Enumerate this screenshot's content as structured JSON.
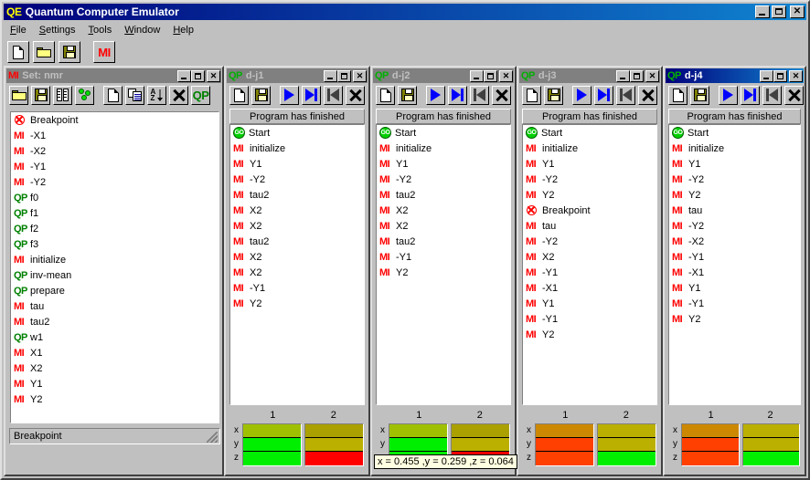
{
  "app": {
    "title": "Quantum Computer Emulator",
    "title_icon": "QE",
    "sys": {
      "minimize": "–",
      "maximize": "□",
      "close": "✕"
    }
  },
  "menu": {
    "items": [
      {
        "label": "File",
        "accel": "F"
      },
      {
        "label": "Settings",
        "accel": "S"
      },
      {
        "label": "Tools",
        "accel": "T"
      },
      {
        "label": "Window",
        "accel": "W"
      },
      {
        "label": "Help",
        "accel": "H"
      }
    ]
  },
  "toolbar": {
    "buttons": [
      {
        "name": "new-file-button",
        "icon": "new-document-icon"
      },
      {
        "name": "open-file-button",
        "icon": "open-folder-icon"
      },
      {
        "name": "save-file-button",
        "icon": "floppy-save-icon"
      },
      {
        "name": "mi-button",
        "icon": "mi-icon",
        "label": "MI"
      }
    ]
  },
  "set_window": {
    "title": "Set: nmr",
    "title_icon": "MI",
    "active": false,
    "toolbar": [
      {
        "name": "open-set-button",
        "icon": "open-folder-icon"
      },
      {
        "name": "save-set-button",
        "icon": "floppy-save-icon"
      },
      {
        "name": "machine-button",
        "icon": "two-towers-icon"
      },
      {
        "name": "qubits-button",
        "icon": "green-dots-icon"
      },
      {
        "name": "new-item-button",
        "icon": "new-document-icon"
      },
      {
        "name": "copy-item-button",
        "icon": "copy-pages-icon"
      },
      {
        "name": "sort-button",
        "icon": "sort-az-icon"
      },
      {
        "name": "delete-button",
        "icon": "delete-x-icon"
      },
      {
        "name": "qp-button",
        "icon": "qp-icon",
        "label": "QP"
      }
    ],
    "items": [
      {
        "tag": "BP",
        "label": "Breakpoint"
      },
      {
        "tag": "MI",
        "label": "-X1"
      },
      {
        "tag": "MI",
        "label": "-X2"
      },
      {
        "tag": "MI",
        "label": "-Y1"
      },
      {
        "tag": "MI",
        "label": "-Y2"
      },
      {
        "tag": "QP",
        "label": "f0"
      },
      {
        "tag": "QP",
        "label": "f1"
      },
      {
        "tag": "QP",
        "label": "f2"
      },
      {
        "tag": "QP",
        "label": "f3"
      },
      {
        "tag": "MI",
        "label": "initialize"
      },
      {
        "tag": "QP",
        "label": "inv-mean"
      },
      {
        "tag": "QP",
        "label": "prepare"
      },
      {
        "tag": "MI",
        "label": "tau"
      },
      {
        "tag": "MI",
        "label": "tau2"
      },
      {
        "tag": "QP",
        "label": "w1"
      },
      {
        "tag": "MI",
        "label": "X1"
      },
      {
        "tag": "MI",
        "label": "X2"
      },
      {
        "tag": "MI",
        "label": "Y1"
      },
      {
        "tag": "MI",
        "label": "Y2"
      }
    ],
    "status": "Breakpoint"
  },
  "program_windows": [
    {
      "name": "d-j1",
      "title": "d-j1",
      "title_icon": "QP",
      "active": false,
      "status_header": "Program has finished",
      "toolbar": [
        {
          "name": "new-program-button",
          "icon": "new-document-icon"
        },
        {
          "name": "save-program-button",
          "icon": "floppy-save-icon"
        },
        {
          "name": "run-button",
          "icon": "play-icon"
        },
        {
          "name": "run-to-end-button",
          "icon": "play-to-end-icon"
        },
        {
          "name": "rewind-button",
          "icon": "rewind-icon"
        },
        {
          "name": "stop-button",
          "icon": "delete-x-icon"
        }
      ],
      "items": [
        {
          "tag": "GO",
          "label": "Start"
        },
        {
          "tag": "MI",
          "label": "initialize"
        },
        {
          "tag": "MI",
          "label": "Y1"
        },
        {
          "tag": "MI",
          "label": "-Y2"
        },
        {
          "tag": "MI",
          "label": "tau2"
        },
        {
          "tag": "MI",
          "label": "X2"
        },
        {
          "tag": "MI",
          "label": "X2"
        },
        {
          "tag": "MI",
          "label": "tau2"
        },
        {
          "tag": "MI",
          "label": "X2"
        },
        {
          "tag": "MI",
          "label": "X2"
        },
        {
          "tag": "MI",
          "label": "-Y1"
        },
        {
          "tag": "MI",
          "label": "Y2"
        }
      ],
      "bloch": {
        "columns": [
          "1",
          "2"
        ],
        "axes": [
          "x",
          "y",
          "z"
        ],
        "cells": [
          [
            "#9fc000",
            "#00ee00",
            "#00ee00"
          ],
          [
            "#aaa000",
            "#bbb000",
            "#ff0000"
          ]
        ]
      },
      "tooltip": null
    },
    {
      "name": "d-j2",
      "title": "d-j2",
      "title_icon": "QP",
      "active": false,
      "status_header": "Program has finished",
      "toolbar": [
        {
          "name": "new-program-button",
          "icon": "new-document-icon"
        },
        {
          "name": "save-program-button",
          "icon": "floppy-save-icon"
        },
        {
          "name": "run-button",
          "icon": "play-icon"
        },
        {
          "name": "run-to-end-button",
          "icon": "play-to-end-icon"
        },
        {
          "name": "rewind-button",
          "icon": "rewind-icon"
        },
        {
          "name": "stop-button",
          "icon": "delete-x-icon"
        }
      ],
      "items": [
        {
          "tag": "GO",
          "label": "Start"
        },
        {
          "tag": "MI",
          "label": "initialize"
        },
        {
          "tag": "MI",
          "label": "Y1"
        },
        {
          "tag": "MI",
          "label": "-Y2"
        },
        {
          "tag": "MI",
          "label": "tau2"
        },
        {
          "tag": "MI",
          "label": "X2"
        },
        {
          "tag": "MI",
          "label": "X2"
        },
        {
          "tag": "MI",
          "label": "tau2"
        },
        {
          "tag": "MI",
          "label": "-Y1"
        },
        {
          "tag": "MI",
          "label": "Y2"
        }
      ],
      "bloch": {
        "columns": [
          "1",
          "2"
        ],
        "axes": [
          "x",
          "y",
          "z"
        ],
        "cells": [
          [
            "#9fc000",
            "#00ee00",
            "#00ee00"
          ],
          [
            "#aaa000",
            "#bbb000",
            "#ff0000"
          ]
        ]
      },
      "tooltip": "x = 0.455 ,y = 0.259 ,z = 0.064"
    },
    {
      "name": "d-j3",
      "title": "d-j3",
      "title_icon": "QP",
      "active": false,
      "status_header": "Program has finished",
      "toolbar": [
        {
          "name": "new-program-button",
          "icon": "new-document-icon"
        },
        {
          "name": "save-program-button",
          "icon": "floppy-save-icon"
        },
        {
          "name": "run-button",
          "icon": "play-icon"
        },
        {
          "name": "run-to-end-button",
          "icon": "play-to-end-icon"
        },
        {
          "name": "rewind-button",
          "icon": "rewind-icon"
        },
        {
          "name": "stop-button",
          "icon": "delete-x-icon"
        }
      ],
      "items": [
        {
          "tag": "GO",
          "label": "Start"
        },
        {
          "tag": "MI",
          "label": "initialize"
        },
        {
          "tag": "MI",
          "label": "Y1"
        },
        {
          "tag": "MI",
          "label": "-Y2"
        },
        {
          "tag": "MI",
          "label": "Y2"
        },
        {
          "tag": "BP",
          "label": "Breakpoint"
        },
        {
          "tag": "MI",
          "label": "tau"
        },
        {
          "tag": "MI",
          "label": "-Y2"
        },
        {
          "tag": "MI",
          "label": "X2"
        },
        {
          "tag": "MI",
          "label": "-Y1"
        },
        {
          "tag": "MI",
          "label": "-X1"
        },
        {
          "tag": "MI",
          "label": "Y1"
        },
        {
          "tag": "MI",
          "label": "-Y1"
        },
        {
          "tag": "MI",
          "label": "Y2"
        }
      ],
      "bloch": {
        "columns": [
          "1",
          "2"
        ],
        "axes": [
          "x",
          "y",
          "z"
        ],
        "cells": [
          [
            "#cc8800",
            "#ff4000",
            "#ff4000"
          ],
          [
            "#bbb000",
            "#bbb000",
            "#00ee00"
          ]
        ]
      },
      "tooltip": null
    },
    {
      "name": "d-j4",
      "title": "d-j4",
      "title_icon": "QP",
      "active": true,
      "status_header": "Program has finished",
      "toolbar": [
        {
          "name": "new-program-button",
          "icon": "new-document-icon"
        },
        {
          "name": "save-program-button",
          "icon": "floppy-save-icon"
        },
        {
          "name": "run-button",
          "icon": "play-icon"
        },
        {
          "name": "run-to-end-button",
          "icon": "play-to-end-icon"
        },
        {
          "name": "rewind-button",
          "icon": "rewind-icon"
        },
        {
          "name": "stop-button",
          "icon": "delete-x-icon"
        }
      ],
      "items": [
        {
          "tag": "GO",
          "label": "Start"
        },
        {
          "tag": "MI",
          "label": "initialize"
        },
        {
          "tag": "MI",
          "label": "Y1"
        },
        {
          "tag": "MI",
          "label": "-Y2"
        },
        {
          "tag": "MI",
          "label": "Y2"
        },
        {
          "tag": "MI",
          "label": "tau"
        },
        {
          "tag": "MI",
          "label": "-Y2"
        },
        {
          "tag": "MI",
          "label": "-X2"
        },
        {
          "tag": "MI",
          "label": "-Y1"
        },
        {
          "tag": "MI",
          "label": "-X1"
        },
        {
          "tag": "MI",
          "label": "Y1"
        },
        {
          "tag": "MI",
          "label": "-Y1"
        },
        {
          "tag": "MI",
          "label": "Y2"
        }
      ],
      "bloch": {
        "columns": [
          "1",
          "2"
        ],
        "axes": [
          "x",
          "y",
          "z"
        ],
        "cells": [
          [
            "#cc8800",
            "#ff4000",
            "#ff4000"
          ],
          [
            "#bbb000",
            "#bbb000",
            "#00ee00"
          ]
        ]
      },
      "tooltip": null
    }
  ],
  "colors": {
    "title_active_left": "#00007b",
    "title_active_right": "#1084d0",
    "title_inactive": "#808080",
    "face": "#c0c0c0",
    "mi_red": "#ff0000",
    "qp_green": "#008000"
  }
}
